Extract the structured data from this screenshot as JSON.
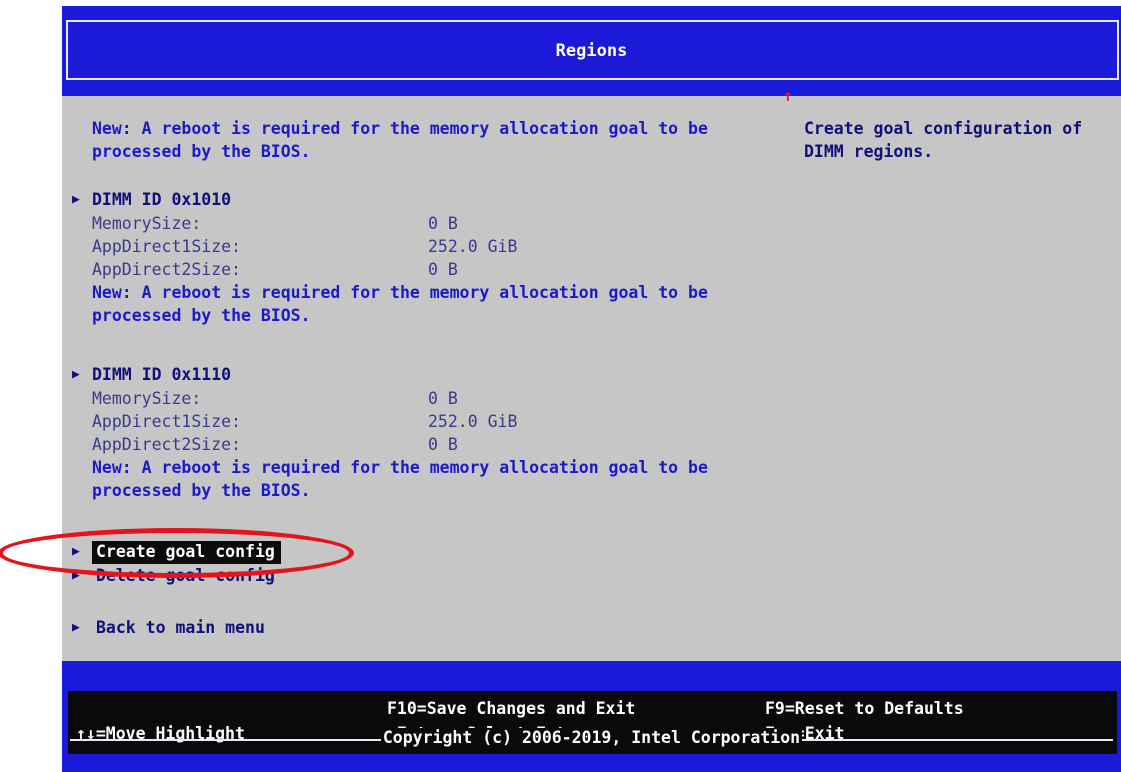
{
  "header": {
    "title": "Regions"
  },
  "intro": {
    "line1": "New: A reboot is required for the memory allocation goal to be",
    "line2": "processed by the BIOS."
  },
  "help": {
    "line1": "Create goal configuration of",
    "line2": "DIMM regions."
  },
  "dimms": [
    {
      "title": "DIMM ID 0x1010",
      "rows": [
        {
          "label": "MemorySize:",
          "value": "0 B"
        },
        {
          "label": "AppDirect1Size:",
          "value": "252.0 GiB"
        },
        {
          "label": "AppDirect2Size:",
          "value": "0 B"
        }
      ],
      "note1": "New: A reboot is required for the memory allocation goal to be",
      "note2": "processed by the BIOS."
    },
    {
      "title": "DIMM ID 0x1110",
      "rows": [
        {
          "label": "MemorySize:",
          "value": "0 B"
        },
        {
          "label": "AppDirect1Size:",
          "value": "252.0 GiB"
        },
        {
          "label": "AppDirect2Size:",
          "value": "0 B"
        }
      ],
      "note1": "New: A reboot is required for the memory allocation goal to be",
      "note2": "processed by the BIOS."
    }
  ],
  "actions": {
    "create": "Create goal config",
    "delete": "Delete goal config",
    "back": "Back to main menu"
  },
  "footer": {
    "move": "↑↓=Move Highlight",
    "save": "F10=Save Changes and Exit",
    "select": "<Enter>=Select Entry",
    "reset": "F9=Reset to Defaults",
    "exit": "Esc=Exit",
    "copyright": "Copyright (c) 2006-2019, Intel Corporation"
  },
  "icons": {
    "submenu": "submenu-arrow-icon",
    "scroll": "scroll-up-icon"
  },
  "colors": {
    "header_bg": "#1a1ad8",
    "body_bg": "#c6c6c6",
    "highlight_bg": "#0b0b0b",
    "annotation": "#e3141b"
  }
}
